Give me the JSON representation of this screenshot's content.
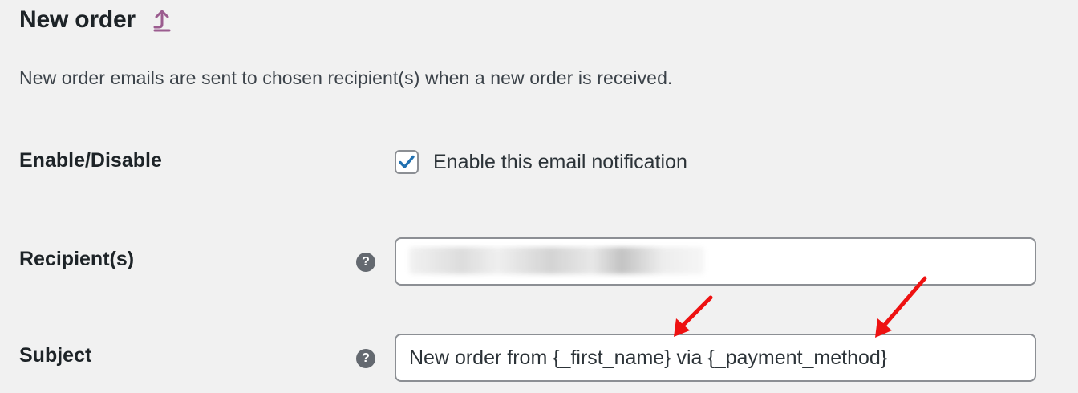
{
  "header": {
    "title": "New order",
    "up_link_icon": "arrow-up-icon",
    "up_link_color": "#9b5c8f"
  },
  "description": "New order emails are sent to chosen recipient(s) when a new order is received.",
  "fields": {
    "enable": {
      "label": "Enable/Disable",
      "checkbox_label": "Enable this email notification",
      "checked": true,
      "check_color": "#2271b1"
    },
    "recipients": {
      "label": "Recipient(s)",
      "help_icon": "question-mark-icon",
      "value": ""
    },
    "subject": {
      "label": "Subject",
      "help_icon": "question-mark-icon",
      "value": "New order from {_first_name} via {_payment_method}"
    }
  },
  "annotations": {
    "arrow_color": "#ee1111",
    "count": 2
  }
}
